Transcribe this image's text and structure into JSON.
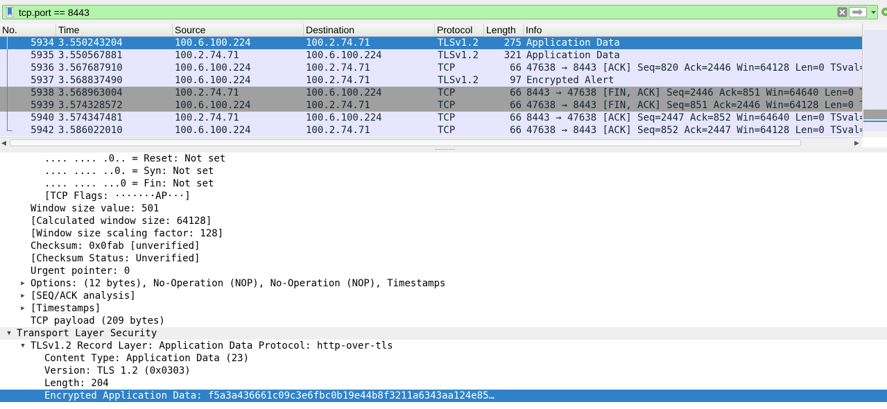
{
  "filter": {
    "value": "tcp.port == 8443",
    "icons": [
      "bookmark-icon",
      "clear-icon",
      "apply-arrow-icon",
      "dropdown-icon",
      "add-filter-icon"
    ],
    "bg_color": "#b2f5aa"
  },
  "packet_list": {
    "columns": [
      "No.",
      "Time",
      "Source",
      "Destination",
      "Protocol",
      "Length",
      "Info"
    ],
    "rows": [
      {
        "no": "5934",
        "time": "3.550243204",
        "src": "100.6.100.224",
        "dst": "100.2.74.71",
        "proto": "TLSv1.2",
        "len": "275",
        "info": "Application Data",
        "bg": "#2f82c8",
        "fg": "#ffffff",
        "selected": true
      },
      {
        "no": "5935",
        "time": "3.550567881",
        "src": "100.2.74.71",
        "dst": "100.6.100.224",
        "proto": "TLSv1.2",
        "len": "321",
        "info": "Application Data",
        "bg": "#e7e6fe",
        "fg": "#12272e"
      },
      {
        "no": "5936",
        "time": "3.567687910",
        "src": "100.6.100.224",
        "dst": "100.2.74.71",
        "proto": "TCP",
        "len": "66",
        "info": "47638 → 8443 [ACK] Seq=820 Ack=2446 Win=64128 Len=0 TSval=",
        "bg": "#e7e6fe",
        "fg": "#12272e"
      },
      {
        "no": "5937",
        "time": "3.568837490",
        "src": "100.6.100.224",
        "dst": "100.2.74.71",
        "proto": "TLSv1.2",
        "len": "97",
        "info": "Encrypted Alert",
        "bg": "#e7e6fe",
        "fg": "#12272e"
      },
      {
        "no": "5938",
        "time": "3.568963004",
        "src": "100.2.74.71",
        "dst": "100.6.100.224",
        "proto": "TCP",
        "len": "66",
        "info": "8443 → 47638 [FIN, ACK] Seq=2446 Ack=851 Win=64640 Len=0 T",
        "bg": "#a0a0a0",
        "fg": "#12272e"
      },
      {
        "no": "5939",
        "time": "3.574328572",
        "src": "100.6.100.224",
        "dst": "100.2.74.71",
        "proto": "TCP",
        "len": "66",
        "info": "47638 → 8443 [FIN, ACK] Seq=851 Ack=2446 Win=64128 Len=0 T",
        "bg": "#a0a0a0",
        "fg": "#12272e"
      },
      {
        "no": "5940",
        "time": "3.574347481",
        "src": "100.2.74.71",
        "dst": "100.6.100.224",
        "proto": "TCP",
        "len": "66",
        "info": "8443 → 47638 [ACK] Seq=2447 Ack=852 Win=64640 Len=0 TSval=",
        "bg": "#e7e6fe",
        "fg": "#12272e"
      },
      {
        "no": "5942",
        "time": "3.586022010",
        "src": "100.6.100.224",
        "dst": "100.2.74.71",
        "proto": "TCP",
        "len": "66",
        "info": "47638 → 8443 [ACK] Seq=852 Ack=2447 Win=64128 Len=0 TSval=",
        "bg": "#e7e6fe",
        "fg": "#12272e"
      }
    ]
  },
  "details": {
    "lines": [
      {
        "text": ".... .... .0.. = Reset: Not set",
        "indent": 3,
        "arrow": ""
      },
      {
        "text": ".... .... ..0. = Syn: Not set",
        "indent": 3,
        "arrow": ""
      },
      {
        "text": ".... .... ...0 = Fin: Not set",
        "indent": 3,
        "arrow": ""
      },
      {
        "text": "[TCP Flags: ·······AP···]",
        "indent": 3,
        "arrow": ""
      },
      {
        "text": "Window size value: 501",
        "indent": 2,
        "arrow": ""
      },
      {
        "text": "[Calculated window size: 64128]",
        "indent": 2,
        "arrow": ""
      },
      {
        "text": "[Window size scaling factor: 128]",
        "indent": 2,
        "arrow": ""
      },
      {
        "text": "Checksum: 0x0fab [unverified]",
        "indent": 2,
        "arrow": ""
      },
      {
        "text": "[Checksum Status: Unverified]",
        "indent": 2,
        "arrow": ""
      },
      {
        "text": "Urgent pointer: 0",
        "indent": 2,
        "arrow": ""
      },
      {
        "text": "Options: (12 bytes), No-Operation (NOP), No-Operation (NOP), Timestamps",
        "indent": 2,
        "arrow": "collapsed"
      },
      {
        "text": "[SEQ/ACK analysis]",
        "indent": 2,
        "arrow": "collapsed"
      },
      {
        "text": "[Timestamps]",
        "indent": 2,
        "arrow": "collapsed"
      },
      {
        "text": "TCP payload (209 bytes)",
        "indent": 2,
        "arrow": ""
      },
      {
        "text": "Transport Layer Security",
        "indent": 1,
        "arrow": "expanded",
        "bg": "#efefef"
      },
      {
        "text": "TLSv1.2 Record Layer: Application Data Protocol: http-over-tls",
        "indent": 2,
        "arrow": "expanded"
      },
      {
        "text": "Content Type: Application Data (23)",
        "indent": 3,
        "arrow": ""
      },
      {
        "text": "Version: TLS 1.2 (0x0303)",
        "indent": 3,
        "arrow": ""
      },
      {
        "text": "Length: 204",
        "indent": 3,
        "arrow": ""
      },
      {
        "text": "Encrypted Application Data: f5a3a436661c09c3e6fbc0b19e44b8f3211a6343aa124e85…",
        "indent": 3,
        "arrow": "",
        "selected": true,
        "bg": "#2f82c8",
        "fg": "#ffffff"
      }
    ]
  }
}
